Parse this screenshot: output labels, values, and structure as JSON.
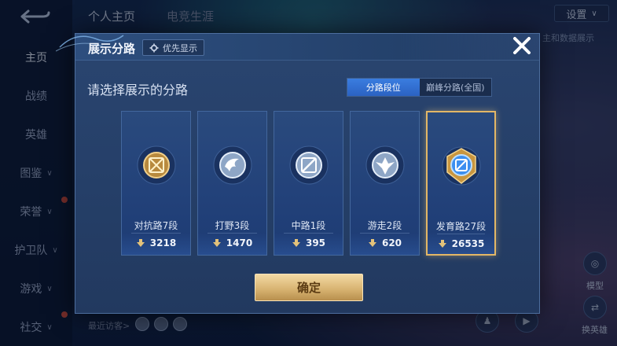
{
  "background": {
    "tabs": [
      "个人主页",
      "电竞生涯"
    ],
    "nav_items": [
      {
        "label": "主页",
        "chevron": false
      },
      {
        "label": "战绩",
        "chevron": false
      },
      {
        "label": "英雄",
        "chevron": false
      },
      {
        "label": "图鉴",
        "chevron": true
      },
      {
        "label": "荣誉",
        "chevron": true
      },
      {
        "label": "护卫队",
        "chevron": true
      },
      {
        "label": "游戏",
        "chevron": true
      },
      {
        "label": "社交",
        "chevron": true
      }
    ],
    "settings_label": "设置",
    "hint_text": "主和数据展示",
    "model_label": "模型",
    "change_hero_label": "换英雄",
    "recent_visitors_label": "最近访客>"
  },
  "modal": {
    "title": "展示分路",
    "priority_label": "优先显示",
    "subtitle": "请选择展示的分路",
    "mode_tabs": [
      {
        "label": "分路段位",
        "active": true
      },
      {
        "label": "巅峰分路(全国)",
        "active": false
      }
    ],
    "confirm_label": "确定"
  },
  "lanes": [
    {
      "name": "对抗路7段",
      "score": "3218",
      "emblem": "clash-lane-emblem-icon",
      "selected": false
    },
    {
      "name": "打野3段",
      "score": "1470",
      "emblem": "jungle-emblem-icon",
      "selected": false
    },
    {
      "name": "中路1段",
      "score": "395",
      "emblem": "mid-lane-emblem-icon",
      "selected": false
    },
    {
      "name": "游走2段",
      "score": "620",
      "emblem": "roam-emblem-icon",
      "selected": false
    },
    {
      "name": "发育路27段",
      "score": "26535",
      "emblem": "farm-lane-emblem-icon",
      "selected": true
    }
  ],
  "colors": {
    "accent_blue": "#2b62c2",
    "gold": "#e3b766",
    "panel": "#253f68"
  }
}
